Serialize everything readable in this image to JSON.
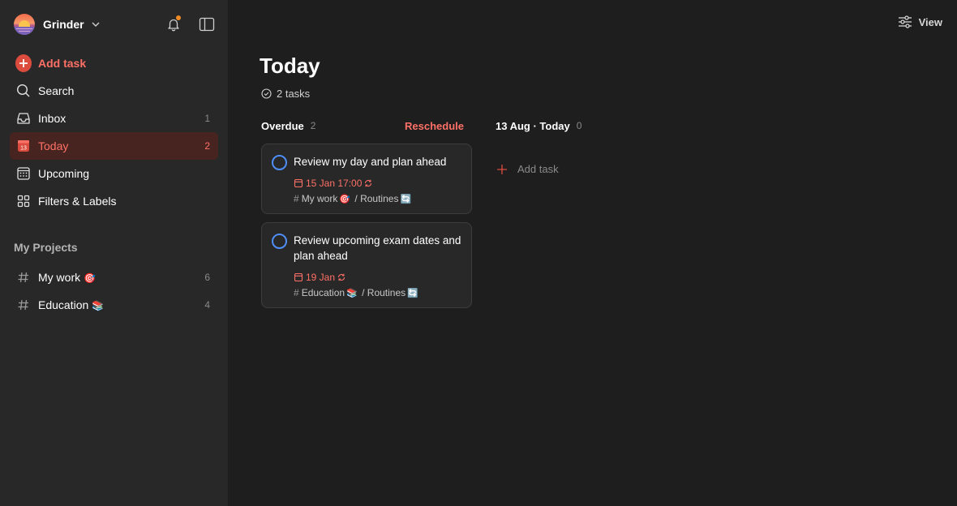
{
  "workspace": {
    "name": "Grinder"
  },
  "sidebar": {
    "add_task_label": "Add task",
    "nav": [
      {
        "label": "Search",
        "count": "",
        "icon": "search-icon"
      },
      {
        "label": "Inbox",
        "count": "1",
        "icon": "inbox-icon"
      },
      {
        "label": "Today",
        "count": "2",
        "icon": "calendar-today-icon",
        "active": true
      },
      {
        "label": "Upcoming",
        "count": "",
        "icon": "calendar-grid-icon"
      },
      {
        "label": "Filters & Labels",
        "count": "",
        "icon": "grid-icon"
      }
    ],
    "projects_title": "My Projects",
    "projects": [
      {
        "label": "My work",
        "emoji": "🎯",
        "count": "6"
      },
      {
        "label": "Education",
        "emoji": "📚",
        "count": "4"
      }
    ]
  },
  "header": {
    "view_label": "View"
  },
  "main": {
    "title": "Today",
    "task_count_label": "2 tasks",
    "columns": [
      {
        "title": "Overdue",
        "count": "2",
        "action_label": "Reschedule",
        "tasks": [
          {
            "title": "Review my day and plan ahead",
            "due": "15 Jan 17:00",
            "project": "My work",
            "project_emoji": "🎯",
            "section": "Routines",
            "section_emoji": "🔄"
          },
          {
            "title": "Review upcoming exam dates and plan ahead",
            "due": "19 Jan",
            "project": "Education",
            "project_emoji": "📚",
            "section": "Routines",
            "section_emoji": "🔄"
          }
        ]
      },
      {
        "title": "13 Aug · Today",
        "count": "0",
        "add_label": "Add task"
      }
    ]
  },
  "colors": {
    "accent": "#dc4c3e",
    "accent_text": "#ff7066",
    "checkbox": "#4f8ef7",
    "notification": "#f08a24"
  }
}
